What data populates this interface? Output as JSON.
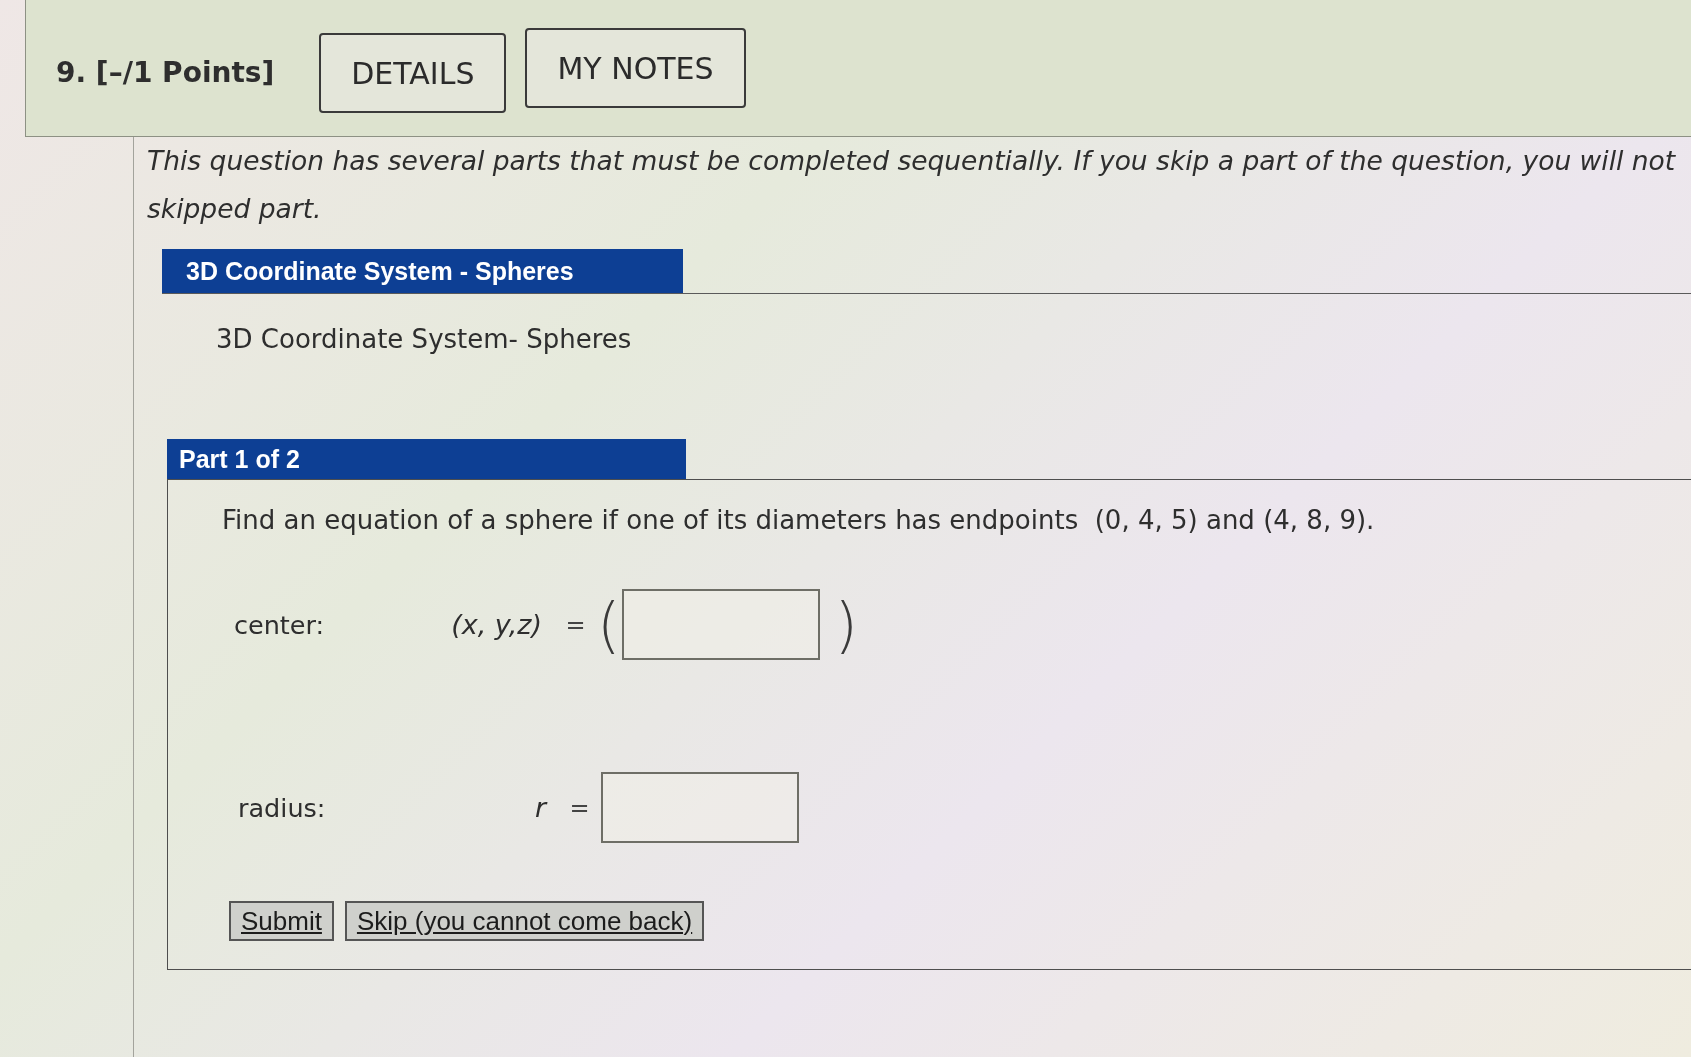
{
  "question": {
    "title": "9. [–/1 Points]",
    "buttons": [
      {
        "label": "DETAILS"
      },
      {
        "label": "MY NOTES"
      }
    ]
  },
  "instructions": [
    "This question has several parts that must be completed sequentially. If you skip a part of the question, you will not",
    "skipped part."
  ],
  "section": {
    "title": "3D Coordinate System - Spheres",
    "subtitle": "3D Coordinate System- Spheres"
  },
  "part": {
    "title": "Part 1 of 2",
    "prompt": "Find an equation of a sphere if one of its diameters has endpoints  (0, 4, 5) and (4, 8, 9).",
    "answers": [
      {
        "kind": "tuple",
        "label": "center:",
        "variable": "(x, y,z)",
        "equals": "=",
        "open": "(",
        "close": ")"
      },
      {
        "kind": "scalar",
        "label": "radius:",
        "variable": "r",
        "equals": "="
      }
    ],
    "buttons": [
      {
        "label": "Submit"
      },
      {
        "label": "Skip (you cannot come back)"
      }
    ]
  }
}
